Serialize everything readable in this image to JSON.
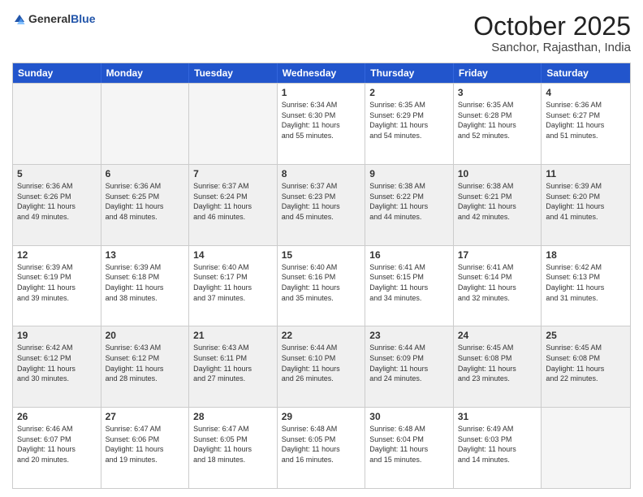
{
  "header": {
    "logo_general": "General",
    "logo_blue": "Blue",
    "month": "October 2025",
    "location": "Sanchor, Rajasthan, India"
  },
  "days_of_week": [
    "Sunday",
    "Monday",
    "Tuesday",
    "Wednesday",
    "Thursday",
    "Friday",
    "Saturday"
  ],
  "rows": [
    [
      {
        "day": "",
        "info": ""
      },
      {
        "day": "",
        "info": ""
      },
      {
        "day": "",
        "info": ""
      },
      {
        "day": "1",
        "info": "Sunrise: 6:34 AM\nSunset: 6:30 PM\nDaylight: 11 hours\nand 55 minutes."
      },
      {
        "day": "2",
        "info": "Sunrise: 6:35 AM\nSunset: 6:29 PM\nDaylight: 11 hours\nand 54 minutes."
      },
      {
        "day": "3",
        "info": "Sunrise: 6:35 AM\nSunset: 6:28 PM\nDaylight: 11 hours\nand 52 minutes."
      },
      {
        "day": "4",
        "info": "Sunrise: 6:36 AM\nSunset: 6:27 PM\nDaylight: 11 hours\nand 51 minutes."
      }
    ],
    [
      {
        "day": "5",
        "info": "Sunrise: 6:36 AM\nSunset: 6:26 PM\nDaylight: 11 hours\nand 49 minutes."
      },
      {
        "day": "6",
        "info": "Sunrise: 6:36 AM\nSunset: 6:25 PM\nDaylight: 11 hours\nand 48 minutes."
      },
      {
        "day": "7",
        "info": "Sunrise: 6:37 AM\nSunset: 6:24 PM\nDaylight: 11 hours\nand 46 minutes."
      },
      {
        "day": "8",
        "info": "Sunrise: 6:37 AM\nSunset: 6:23 PM\nDaylight: 11 hours\nand 45 minutes."
      },
      {
        "day": "9",
        "info": "Sunrise: 6:38 AM\nSunset: 6:22 PM\nDaylight: 11 hours\nand 44 minutes."
      },
      {
        "day": "10",
        "info": "Sunrise: 6:38 AM\nSunset: 6:21 PM\nDaylight: 11 hours\nand 42 minutes."
      },
      {
        "day": "11",
        "info": "Sunrise: 6:39 AM\nSunset: 6:20 PM\nDaylight: 11 hours\nand 41 minutes."
      }
    ],
    [
      {
        "day": "12",
        "info": "Sunrise: 6:39 AM\nSunset: 6:19 PM\nDaylight: 11 hours\nand 39 minutes."
      },
      {
        "day": "13",
        "info": "Sunrise: 6:39 AM\nSunset: 6:18 PM\nDaylight: 11 hours\nand 38 minutes."
      },
      {
        "day": "14",
        "info": "Sunrise: 6:40 AM\nSunset: 6:17 PM\nDaylight: 11 hours\nand 37 minutes."
      },
      {
        "day": "15",
        "info": "Sunrise: 6:40 AM\nSunset: 6:16 PM\nDaylight: 11 hours\nand 35 minutes."
      },
      {
        "day": "16",
        "info": "Sunrise: 6:41 AM\nSunset: 6:15 PM\nDaylight: 11 hours\nand 34 minutes."
      },
      {
        "day": "17",
        "info": "Sunrise: 6:41 AM\nSunset: 6:14 PM\nDaylight: 11 hours\nand 32 minutes."
      },
      {
        "day": "18",
        "info": "Sunrise: 6:42 AM\nSunset: 6:13 PM\nDaylight: 11 hours\nand 31 minutes."
      }
    ],
    [
      {
        "day": "19",
        "info": "Sunrise: 6:42 AM\nSunset: 6:12 PM\nDaylight: 11 hours\nand 30 minutes."
      },
      {
        "day": "20",
        "info": "Sunrise: 6:43 AM\nSunset: 6:12 PM\nDaylight: 11 hours\nand 28 minutes."
      },
      {
        "day": "21",
        "info": "Sunrise: 6:43 AM\nSunset: 6:11 PM\nDaylight: 11 hours\nand 27 minutes."
      },
      {
        "day": "22",
        "info": "Sunrise: 6:44 AM\nSunset: 6:10 PM\nDaylight: 11 hours\nand 26 minutes."
      },
      {
        "day": "23",
        "info": "Sunrise: 6:44 AM\nSunset: 6:09 PM\nDaylight: 11 hours\nand 24 minutes."
      },
      {
        "day": "24",
        "info": "Sunrise: 6:45 AM\nSunset: 6:08 PM\nDaylight: 11 hours\nand 23 minutes."
      },
      {
        "day": "25",
        "info": "Sunrise: 6:45 AM\nSunset: 6:08 PM\nDaylight: 11 hours\nand 22 minutes."
      }
    ],
    [
      {
        "day": "26",
        "info": "Sunrise: 6:46 AM\nSunset: 6:07 PM\nDaylight: 11 hours\nand 20 minutes."
      },
      {
        "day": "27",
        "info": "Sunrise: 6:47 AM\nSunset: 6:06 PM\nDaylight: 11 hours\nand 19 minutes."
      },
      {
        "day": "28",
        "info": "Sunrise: 6:47 AM\nSunset: 6:05 PM\nDaylight: 11 hours\nand 18 minutes."
      },
      {
        "day": "29",
        "info": "Sunrise: 6:48 AM\nSunset: 6:05 PM\nDaylight: 11 hours\nand 16 minutes."
      },
      {
        "day": "30",
        "info": "Sunrise: 6:48 AM\nSunset: 6:04 PM\nDaylight: 11 hours\nand 15 minutes."
      },
      {
        "day": "31",
        "info": "Sunrise: 6:49 AM\nSunset: 6:03 PM\nDaylight: 11 hours\nand 14 minutes."
      },
      {
        "day": "",
        "info": ""
      }
    ]
  ]
}
